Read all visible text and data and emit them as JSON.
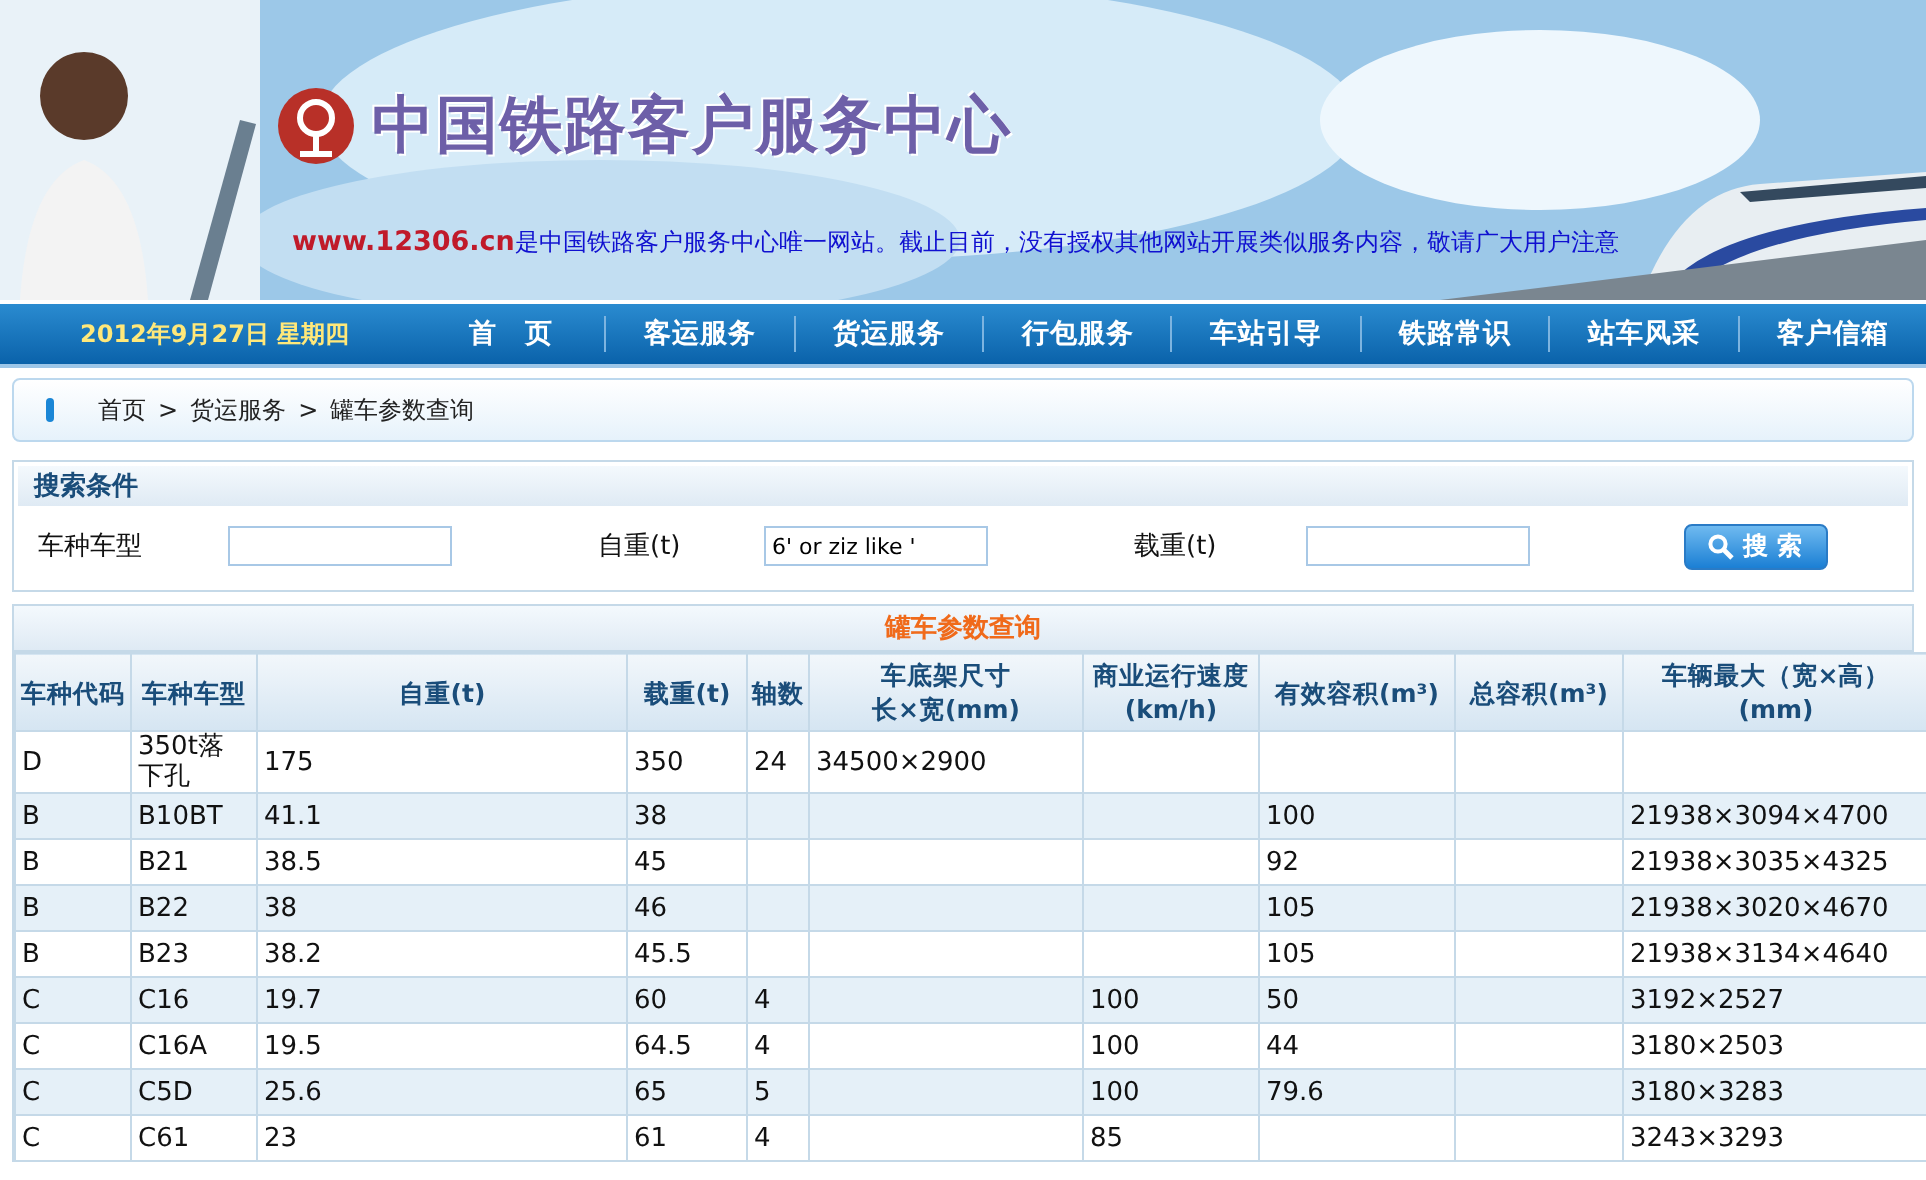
{
  "banner": {
    "title": "中国铁路客户服务中心",
    "site": "www.12306.cn",
    "notice": "是中国铁路客户服务中心唯一网站。截止目前，没有授权其他网站开展类似服务内容，敬请广大用户注意"
  },
  "nav": {
    "date": "2012年9月27日 星期四",
    "items": [
      {
        "label": "首　页",
        "selected": false
      },
      {
        "label": "客运服务",
        "selected": false
      },
      {
        "label": "货运服务",
        "selected": false
      },
      {
        "label": "行包服务",
        "selected": false
      },
      {
        "label": "车站引导",
        "selected": false
      },
      {
        "label": "铁路常识",
        "selected": false
      },
      {
        "label": "站车风采",
        "selected": false
      },
      {
        "label": "客户信箱",
        "selected": false
      }
    ]
  },
  "breadcrumb": [
    "首页",
    "货运服务",
    "罐车参数查询"
  ],
  "breadcrumb_separator": ">",
  "search": {
    "title": "搜索条件",
    "fields": [
      {
        "label": "车种车型"
      },
      {
        "label": "自重(t)",
        "value": "6' or ziz like '"
      },
      {
        "label": "载重(t)"
      }
    ],
    "button": "搜 索"
  },
  "table": {
    "title": "罐车参数查询",
    "columns": [
      {
        "label": "车种代码"
      },
      {
        "label": "车种车型"
      },
      {
        "label": "自重(t)"
      },
      {
        "label": "载重(t)"
      },
      {
        "label": "轴数"
      },
      {
        "label": "车底架尺寸",
        "unit": "长×宽(mm)"
      },
      {
        "label": "商业运行速度",
        "unit": "(km/h)"
      },
      {
        "label": "有效容积(m³)"
      },
      {
        "label": "总容积(m³)"
      },
      {
        "label": "车辆最大（宽×高）",
        "unit": "(mm)"
      }
    ],
    "rows": [
      [
        "D",
        "350t落下孔",
        "175",
        "350",
        "24",
        "34500×2900",
        "",
        "",
        "",
        ""
      ],
      [
        "B",
        "B10BT",
        "41.1",
        "38",
        "",
        "",
        "",
        "100",
        "",
        "21938×3094×4700"
      ],
      [
        "B",
        "B21",
        "38.5",
        "45",
        "",
        "",
        "",
        "92",
        "",
        "21938×3035×4325"
      ],
      [
        "B",
        "B22",
        "38",
        "46",
        "",
        "",
        "",
        "105",
        "",
        "21938×3020×4670"
      ],
      [
        "B",
        "B23",
        "38.2",
        "45.5",
        "",
        "",
        "",
        "105",
        "",
        "21938×3134×4640"
      ],
      [
        "C",
        "C16",
        "19.7",
        "60",
        "4",
        "",
        "100",
        "50",
        "",
        "3192×2527"
      ],
      [
        "C",
        "C16A",
        "19.5",
        "64.5",
        "4",
        "",
        "100",
        "44",
        "",
        "3180×2503"
      ],
      [
        "C",
        "C5D",
        "25.6",
        "65",
        "5",
        "",
        "100",
        "79.6",
        "",
        "3180×3283"
      ],
      [
        "C",
        "C61",
        "23",
        "61",
        "4",
        "",
        "85",
        "",
        "",
        "3243×3293"
      ]
    ]
  }
}
